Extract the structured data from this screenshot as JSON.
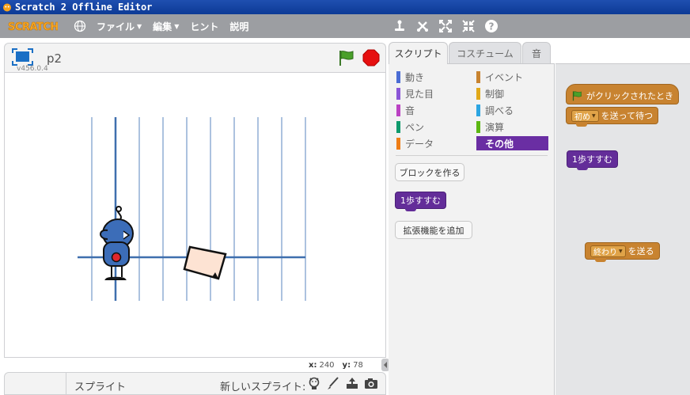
{
  "window": {
    "title": "Scratch 2 Offline Editor"
  },
  "menubar": {
    "logo": "SCRATCH",
    "globe_icon": "globe-icon",
    "items": [
      {
        "label": "ファイル"
      },
      {
        "label": "編集"
      },
      {
        "label": "ヒント"
      },
      {
        "label": "説明"
      }
    ],
    "tool_icons": [
      "duplicate-icon",
      "delete-icon",
      "grow-icon",
      "shrink-icon",
      "help-icon"
    ]
  },
  "stage": {
    "project_title": "p2",
    "version": "v456.0.4",
    "coords": {
      "x_label": "x:",
      "x_value": "240",
      "y_label": "y:",
      "y_value": "78"
    }
  },
  "sprites": {
    "label": "スプライト",
    "new_sprite_label": "新しいスプライト:"
  },
  "tabs": [
    {
      "label": "スクリプト"
    },
    {
      "label": "コスチューム"
    },
    {
      "label": "音"
    }
  ],
  "categories": [
    {
      "label": "動き",
      "color": "#4a6cd4"
    },
    {
      "label": "見た目",
      "color": "#8a55d7"
    },
    {
      "label": "音",
      "color": "#bb42c3"
    },
    {
      "label": "ペン",
      "color": "#0e9a6c"
    },
    {
      "label": "データ",
      "color": "#ee7d16"
    },
    {
      "label": "イベント",
      "color": "#c88330"
    },
    {
      "label": "制御",
      "color": "#e1a91a"
    },
    {
      "label": "調べる",
      "color": "#2ca5e2"
    },
    {
      "label": "演算",
      "color": "#5cb712"
    },
    {
      "label": "その他",
      "color": "#632d99"
    }
  ],
  "palette": {
    "make_block_button": "ブロックを作る",
    "custom_block": "1歩すすむ",
    "add_extension_button": "拡張機能を追加"
  },
  "scripts": {
    "hat_block": "がクリックされたとき",
    "broadcast_wait": {
      "dropdown": "初め",
      "text": "を送って待つ"
    },
    "custom_block": "1歩すすむ",
    "broadcast": {
      "dropdown": "終わり",
      "text": "を送る"
    }
  }
}
